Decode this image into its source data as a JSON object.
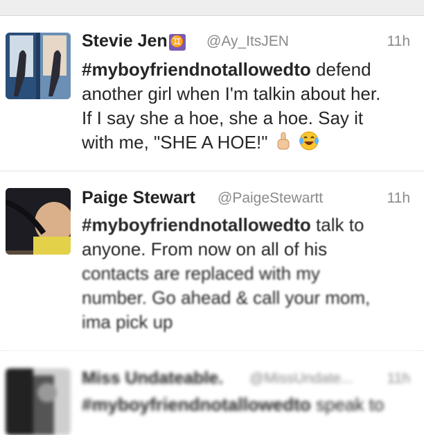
{
  "tweets": [
    {
      "name": "Stevie Jen",
      "badge": "♊",
      "handle": "@Ay_ItsJEN",
      "time": "11h",
      "hashtag": "#myboyfriendnotallowedto",
      "line1_rest": " defend",
      "line2": "another girl when I'm talkin about her.",
      "line3": "If I say she a hoe, she a hoe. Say it",
      "line4": "with me, \"SHE A HOE!\"",
      "emojis": [
        "finger-up-emoji",
        "laughing-tears-emoji"
      ]
    },
    {
      "name": "Paige Stewart",
      "handle": "@PaigeStewartt",
      "time": "11h",
      "hashtag": "#myboyfriendnotallowedto",
      "line1_rest": " talk to",
      "line2": "anyone. From now on all of his",
      "line3": "contacts are replaced with my",
      "line4": "number. Go ahead & call your mom,",
      "line5": "ima pick up"
    },
    {
      "name": "Miss Undateable.",
      "handle": "@MissUndate...",
      "time": "11h",
      "hashtag": "#myboyfriendnotallowedto",
      "line1_rest": " speak to"
    }
  ],
  "colors": {
    "text": "#262626",
    "muted": "#8a8a8a",
    "divider": "#e3e3e3",
    "gemini_badge": "#7b5ab6"
  }
}
